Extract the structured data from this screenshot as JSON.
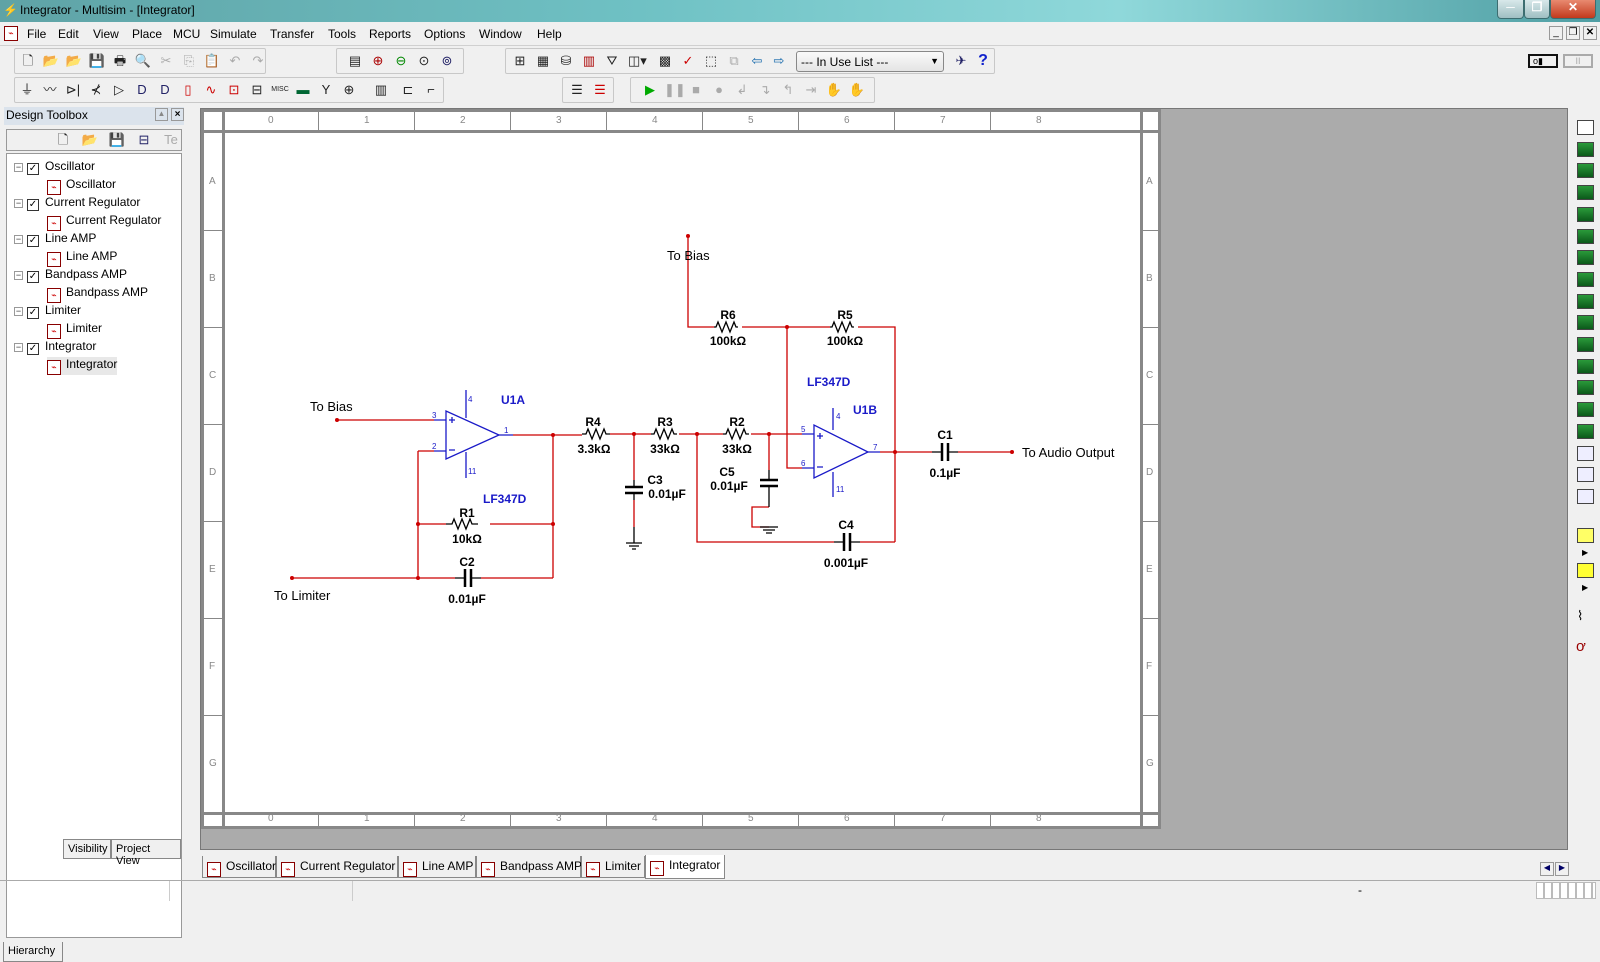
{
  "window": {
    "title": "Integrator - Multisim - [Integrator]",
    "minimize": "─",
    "restore": "❐",
    "close": "✕"
  },
  "menu": [
    "File",
    "Edit",
    "View",
    "Place",
    "MCU",
    "Simulate",
    "Transfer",
    "Tools",
    "Reports",
    "Options",
    "Window",
    "Help"
  ],
  "toolbar": {
    "in_use_list": "--- In Use List ---",
    "help": "?"
  },
  "design_toolbox": {
    "title": "Design Toolbox",
    "tree": [
      {
        "label": "Oscillator",
        "child": "Oscillator"
      },
      {
        "label": "Current Regulator",
        "child": "Current Regulator"
      },
      {
        "label": "Line AMP",
        "child": "Line AMP"
      },
      {
        "label": "Bandpass AMP",
        "child": "Bandpass AMP"
      },
      {
        "label": "Limiter",
        "child": "Limiter"
      },
      {
        "label": "Integrator",
        "child": "Integrator",
        "selected": true
      }
    ],
    "tabs": [
      "Hierarchy",
      "Visibility",
      "Project View"
    ]
  },
  "sheet": {
    "columns": [
      "0",
      "1",
      "2",
      "3",
      "4",
      "5",
      "6",
      "7",
      "8"
    ],
    "rows": [
      "A",
      "B",
      "C",
      "D",
      "E",
      "F",
      "G"
    ]
  },
  "schematic": {
    "wire_color": "#cc0000",
    "part_color": "#1a1ac8",
    "offpage": {
      "bias1": "To Bias",
      "bias2": "To Bias",
      "limiter": "To Limiter",
      "output": "To Audio Output"
    },
    "u1a": {
      "ref": "U1A",
      "model": "LF347D",
      "pins": [
        "3",
        "2",
        "1",
        "4",
        "11"
      ]
    },
    "u1b": {
      "ref": "U1B",
      "model": "LF347D",
      "pins": [
        "5",
        "6",
        "7",
        "4",
        "11"
      ]
    },
    "r1": {
      "ref": "R1",
      "value": "10kΩ"
    },
    "r2": {
      "ref": "R2",
      "value": "33kΩ"
    },
    "r3": {
      "ref": "R3",
      "value": "33kΩ"
    },
    "r4": {
      "ref": "R4",
      "value": "3.3kΩ"
    },
    "r5": {
      "ref": "R5",
      "value": "100kΩ"
    },
    "r6": {
      "ref": "R6",
      "value": "100kΩ"
    },
    "c1": {
      "ref": "C1",
      "value": "0.1µF"
    },
    "c2": {
      "ref": "C2",
      "value": "0.01µF"
    },
    "c3": {
      "ref": "C3",
      "value": "0.01µF"
    },
    "c4": {
      "ref": "C4",
      "value": "0.001µF"
    },
    "c5": {
      "ref": "C5",
      "value": "0.01µF"
    }
  },
  "doc_tabs": [
    "Oscillator",
    "Current Regulator",
    "Line AMP",
    "Bandpass AMP",
    "Limiter",
    "Integrator"
  ],
  "active_doc_tab": "Integrator",
  "status": {
    "center": "-"
  }
}
